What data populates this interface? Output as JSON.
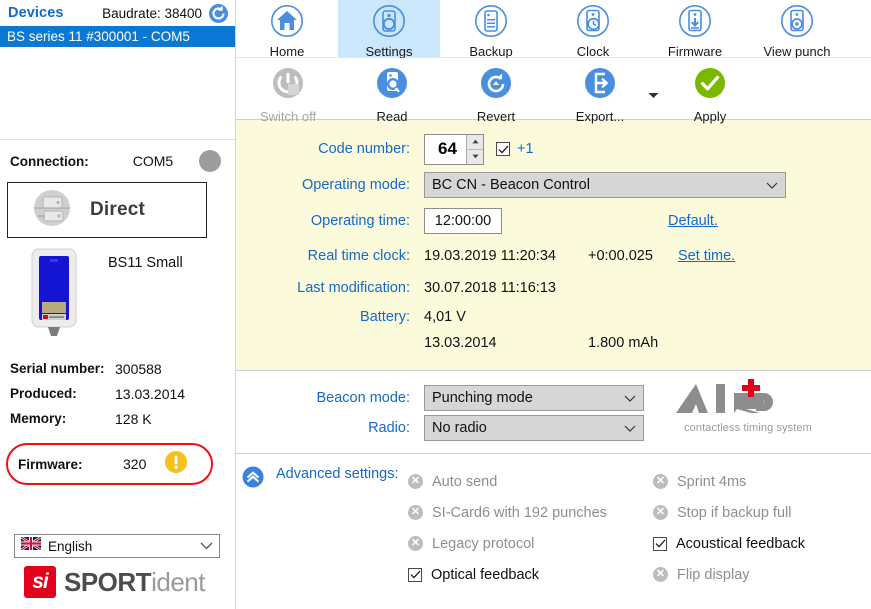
{
  "sidebar": {
    "devices_title": "Devices",
    "baudrate": "Baudrate: 38400",
    "refresh_icon": "refresh-icon",
    "device_entry": "BS series 11 #300001 - COM5",
    "connection_label": "Connection:",
    "connection_value": "COM5",
    "direct_label": "Direct",
    "device_name": "BS11 Small",
    "info": [
      {
        "key": "Serial number:",
        "value": "300588"
      },
      {
        "key": "Produced:",
        "value": "13.03.2014"
      },
      {
        "key": "Memory:",
        "value": "128 K"
      }
    ],
    "firmware": {
      "key": "Firmware:",
      "value": "320",
      "warning_icon": "warning-icon"
    },
    "language": {
      "value": "English",
      "flag_icon": "uk-flag-icon"
    },
    "brand": {
      "mark": "si",
      "bold": "SPORT",
      "light": "ident"
    }
  },
  "ribbon_top": [
    {
      "label": "Home",
      "icon": "home-icon",
      "selected": false
    },
    {
      "label": "Settings",
      "icon": "settings-station-icon",
      "selected": true
    },
    {
      "label": "Backup",
      "icon": "backup-icon",
      "selected": false
    },
    {
      "label": "Clock",
      "icon": "clock-icon",
      "selected": false
    },
    {
      "label": "Firmware",
      "icon": "firmware-download-icon",
      "selected": false
    },
    {
      "label": "View punch",
      "icon": "view-punch-icon",
      "selected": false
    }
  ],
  "ribbon_actions": [
    {
      "label": "Switch off",
      "icon": "power-off-icon",
      "disabled": true
    },
    {
      "label": "Read",
      "icon": "read-icon",
      "disabled": false
    },
    {
      "label": "Revert",
      "icon": "revert-icon",
      "disabled": false
    },
    {
      "label": "Export...",
      "icon": "export-icon",
      "disabled": false
    },
    {
      "label": "Apply",
      "icon": "apply-check-icon",
      "disabled": false
    }
  ],
  "settings": {
    "code_number": {
      "label": "Code number:",
      "value": "64",
      "plus_one_label": "+1",
      "plus_one_checked": true
    },
    "operating_mode": {
      "label": "Operating mode:",
      "value": "BC CN - Beacon Control"
    },
    "operating_time": {
      "label": "Operating time:",
      "value": "12:00:00",
      "default_link": "Default."
    },
    "real_time_clock": {
      "label": "Real time clock:",
      "value": "19.03.2019 11:20:34",
      "offset": "+0:00.025",
      "set_link": "Set time."
    },
    "last_modification": {
      "label": "Last modification:",
      "value": "30.07.2018 11:16:13"
    },
    "battery": {
      "label": "Battery:",
      "voltage": "4,01 V",
      "date": "13.03.2014",
      "capacity": "1.800 mAh"
    }
  },
  "lower": {
    "beacon_mode": {
      "label": "Beacon mode:",
      "value": "Punching mode"
    },
    "radio": {
      "label": "Radio:",
      "value": "No radio"
    },
    "air_logo": {
      "text": "AIR",
      "subtitle": "contactless timing system"
    }
  },
  "advanced": {
    "label": "Advanced settings:",
    "chevron_icon": "chevron-up-circle-icon",
    "column_left": [
      {
        "label": "Auto send",
        "state": "off"
      },
      {
        "label": "SI-Card6 with 192 punches",
        "state": "off"
      },
      {
        "label": "Legacy protocol",
        "state": "off"
      },
      {
        "label": "Optical feedback",
        "state": "checked"
      }
    ],
    "column_right": [
      {
        "label": "Sprint 4ms",
        "state": "off"
      },
      {
        "label": "Stop if backup full",
        "state": "off"
      },
      {
        "label": "Acoustical feedback",
        "state": "checked"
      },
      {
        "label": "Flip display",
        "state": "off"
      }
    ]
  },
  "colors": {
    "accent_blue": "#1569c7",
    "selection_blue": "#0a78d4",
    "panel_yellow": "#fbfbdc",
    "warning_yellow": "#f5c11a",
    "alert_red": "#ee1111",
    "apply_green": "#7ab800",
    "brand_red": "#e2001a"
  }
}
